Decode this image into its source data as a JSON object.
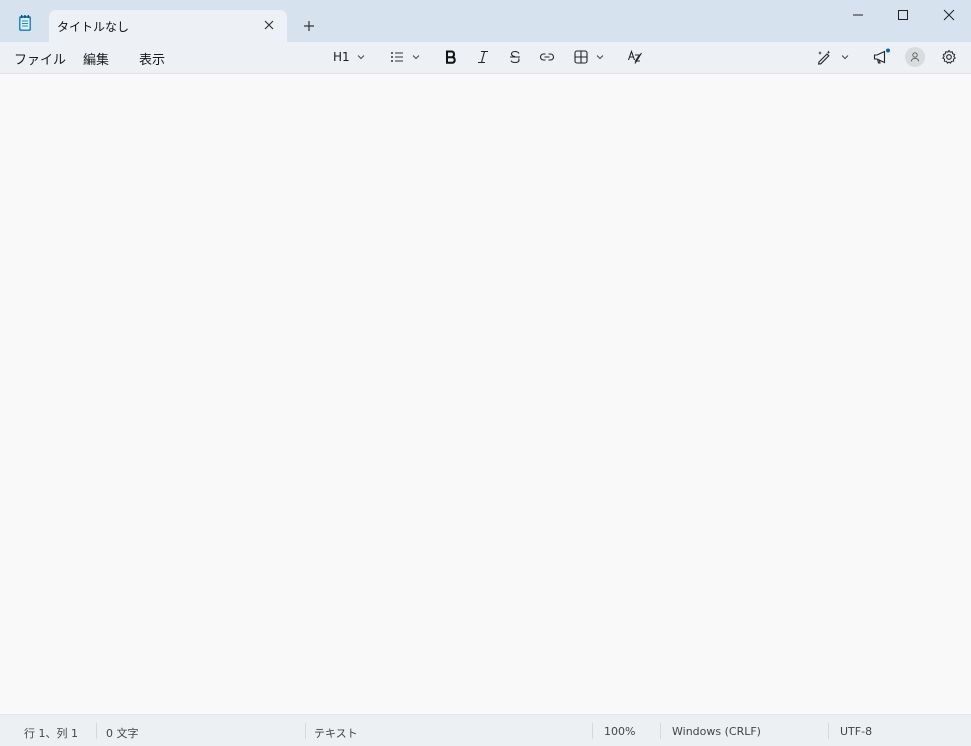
{
  "window": {
    "tab_title": "タイトルなし"
  },
  "menu": {
    "file": "ファイル",
    "edit": "編集",
    "view": "表示"
  },
  "toolbar": {
    "heading_label": "H1"
  },
  "statusbar": {
    "position": "行 1、列 1",
    "char_count": "0 文字",
    "format": "テキスト",
    "zoom": "100%",
    "line_ending": "Windows (CRLF)",
    "encoding": "UTF-8"
  },
  "colors": {
    "titlebar": "#d6e3ee",
    "tab_active": "#edf1f5",
    "editor_bg": "#f9f9f9",
    "accent": "#0067c0"
  },
  "icons": [
    "notepad-app-icon",
    "close-icon",
    "plus-icon",
    "minimize-icon",
    "maximize-icon",
    "window-close-icon",
    "chevron-down-icon",
    "list-icon",
    "bold-icon",
    "italic-icon",
    "strikethrough-icon",
    "link-icon",
    "table-icon",
    "clear-formatting-icon",
    "copilot-pen-icon",
    "megaphone-icon",
    "account-icon",
    "gear-icon"
  ]
}
